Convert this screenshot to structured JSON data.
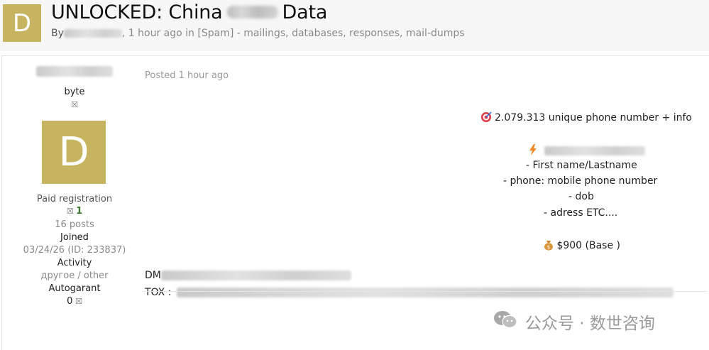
{
  "header": {
    "avatar_letter": "D",
    "title_prefix": "UNLOCKED: China",
    "title_suffix": "Data",
    "by_label": "By",
    "meta_rest": ", 1 hour ago in [Spam] - mailings, databases, responses, mail-dumps"
  },
  "sidebar": {
    "rank": "byte",
    "avatar_letter": "D",
    "group": "Paid registration",
    "reputation": "1",
    "posts": "16 posts",
    "joined_label": "Joined",
    "joined_value": "03/24/26 (ID: 233837)",
    "activity_label": "Activity",
    "activity_value": "другое / other",
    "autogarant_label": "Autogarant",
    "autogarant_value": "0"
  },
  "post": {
    "posted": "Posted 1 hour ago",
    "headline": "2.079.313 unique phone number + info",
    "fields": [
      "- First name/Lastname",
      "- phone:  mobile phone number",
      "- dob",
      "- adress ETC...."
    ],
    "price": "$900 (Base )",
    "dm_label": "DM",
    "tox_label": "TOX :"
  },
  "watermark": {
    "text": "公众号 · 数世咨询"
  },
  "icons": {
    "headline_icon": "target-icon",
    "section_icon": "lightning-icon",
    "price_icon": "money-bag-icon",
    "watermark_icon": "wechat-icon"
  },
  "colors": {
    "avatar_bg": "#c7b461",
    "muted_text": "#8a8a8a",
    "reputation_green": "#3b7a2a"
  }
}
